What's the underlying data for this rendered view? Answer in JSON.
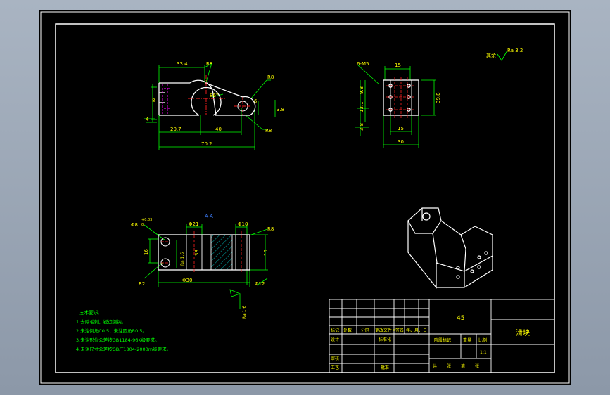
{
  "colors": {
    "background": "#000000",
    "outline": "#ffffff",
    "dimension": "#00ff00",
    "text": "#ffff00",
    "hatch": "#00c8c8",
    "centerline": "#ff2020",
    "hidden": "#ff00ff",
    "marker": "#3d7fff"
  },
  "front_view": {
    "dims": {
      "top_width": "33.4",
      "radius_label": "R8",
      "angle": "86°",
      "left_height": "8",
      "left_bottom": "4",
      "r8_upper": "R8",
      "r8_lower": "R8",
      "right_small": "6",
      "right_right": "3.8",
      "bottom_left": "20.7",
      "bottom_mid": "40",
      "overall": "70.2"
    }
  },
  "side_view": {
    "dims": {
      "hole_label": "6-M5",
      "top": "15",
      "left_a": "9.8",
      "left_b": "13.1",
      "left_c": "3.8",
      "right": "39.8",
      "bottom_inner": "15",
      "bottom_outer": "30"
    }
  },
  "roughness": {
    "prefix": "其余",
    "value": "Ra 3.2"
  },
  "section_view": {
    "marker": "A-A",
    "dims": {
      "hole_top_left": "Φ8",
      "tol_upper": "+0.03",
      "tol_lower": "0",
      "center_top": "Φ21",
      "right_top": "Φ10",
      "r8": "R8",
      "left_height": "16",
      "inner_a": "Ra 1.6",
      "inner_b": "38",
      "bottom_left_r": "R2",
      "bottom_mid": "Φ30",
      "right_h": "10",
      "right_bottom": "Φ12",
      "bottom_ra": "Ra 1.6"
    }
  },
  "tech_notes": {
    "title": "技术要求",
    "items": [
      "1.去除毛刺，锐边倒钝。",
      "2.未注倒角C0.5，未注圆角R0.5。",
      "3.未注形位公差按GB1184-96K级要求。",
      "4.未注尺寸公差按GB/T1804-2000m级要求。"
    ]
  },
  "title_block": {
    "material": "45",
    "part_name": "滑块",
    "row_labels": [
      "标记",
      "处数",
      "分区",
      "更改文件号",
      "签名",
      "年、月、日"
    ],
    "design": "设计",
    "standardize": "标准化",
    "stage_label": "阶段标记",
    "weight_label": "重量",
    "scale_label": "比例",
    "scale": "1:1",
    "review": "审核",
    "process": "工艺",
    "approve": "批准",
    "sheets": [
      "共",
      "张",
      "第",
      "张"
    ]
  }
}
